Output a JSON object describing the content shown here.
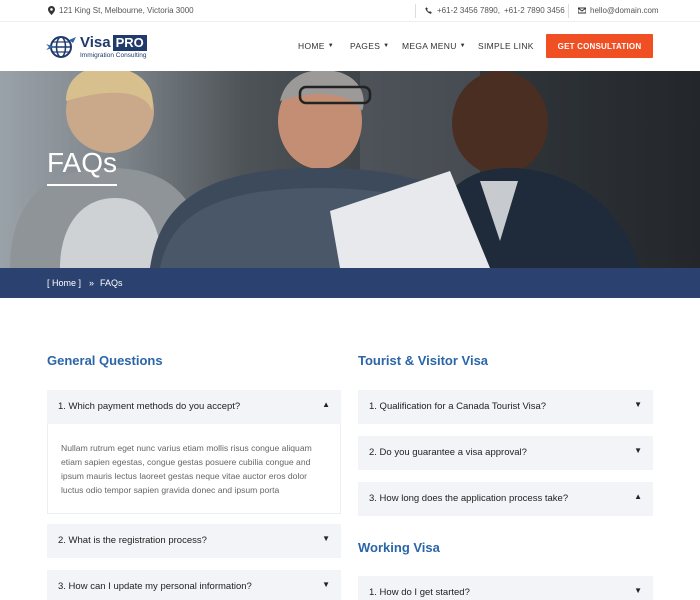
{
  "topbar": {
    "address": "121 King St, Melbourne, Victoria 3000",
    "phone_1": "+61-2 3456 7890,",
    "phone_2": "+61-2 7890 3456",
    "email": "hello@domain.com"
  },
  "logo": {
    "brand": "Visa",
    "badge": "PRO",
    "tagline": "Immigration Consulting"
  },
  "nav": [
    "HOME",
    "PAGES",
    "MEGA MENU",
    "SIMPLE LINK"
  ],
  "cta": "GET CONSULTATION",
  "hero": {
    "title": "FAQs"
  },
  "breadcrumb": {
    "home": "[ Home ]",
    "separator": "»",
    "current": "FAQs"
  },
  "left": {
    "title": "General Questions",
    "items": [
      "1. Which payment methods do you accept?",
      "2. What is the registration process?",
      "3. How can I update my personal information?"
    ],
    "open_body": "Nullam rutrum eget nunc varius etiam mollis risus congue aliquam etiam sapien egestas, congue gestas posuere cubilia congue and ipsum mauris lectus laoreet gestas neque vitae auctor eros dolor luctus odio tempor sapien gravida donec and ipsum porta"
  },
  "right": {
    "tourist_title": "Tourist & Visitor Visa",
    "tourist_items": [
      "1. Qualification for a Canada Tourist Visa?",
      "2. Do you guarantee a visa approval?",
      "3. How long does the application process take?"
    ],
    "working_title": "Working Visa",
    "working_items": [
      "1. How do I get started?"
    ]
  },
  "colors": {
    "accent": "#f04e23",
    "brand": "#1f3a6b",
    "heading": "#2a65a8",
    "breadcrumb_bg": "#2b4270"
  }
}
